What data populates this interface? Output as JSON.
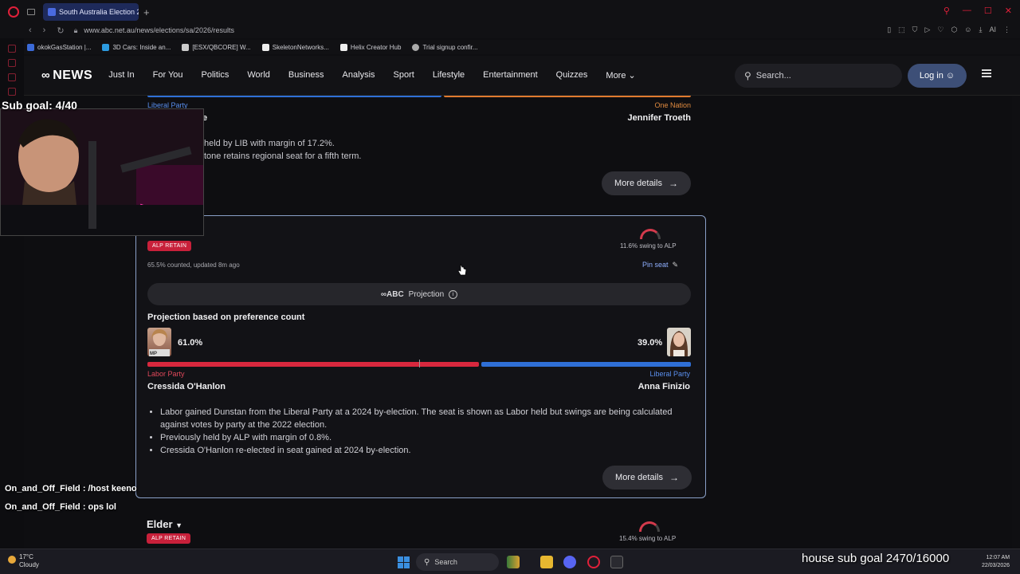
{
  "browser": {
    "tab_title": "South Australia Election 20",
    "url": "www.abc.net.au/news/elections/sa/2026/results",
    "bookmarks": [
      "okokGasStation |...",
      "3D Cars: Inside an...",
      "[ESX/QBCORE] W...",
      "SkeletonNetworks...",
      "Helix Creator Hub",
      "Trial signup confir..."
    ],
    "ai_label": "AI"
  },
  "site": {
    "logo": "NEWS",
    "nav": [
      "Just In",
      "For You",
      "Politics",
      "World",
      "Business",
      "Analysis",
      "Sport",
      "Lifestyle",
      "Entertainment",
      "Quizzes"
    ],
    "more": "More",
    "search_placeholder": "Search...",
    "login": "Log in"
  },
  "prev_card": {
    "left_party": "Liberal Party",
    "left_candidate_partial": "e",
    "right_party": "One Nation",
    "right_candidate": "Jennifer Troeth",
    "bullet1_partial": "held by LIB with margin of 17.2%.",
    "bullet2_partial": "tone retains regional seat for a fifth term.",
    "more_details": "More details",
    "colors": {
      "lib": "#2f6fd6",
      "onenation": "#e07a2f"
    }
  },
  "main_card": {
    "badge": "ALP RETAIN",
    "counted": "65.5% counted, updated 8m ago",
    "swing": "11.6% swing to ALP",
    "pin": "Pin seat",
    "projection_brand": "ABC",
    "projection_label": "Projection",
    "projection_title": "Projection based on preference count",
    "left": {
      "pct": "61.0%",
      "party": "Labor Party",
      "candidate": "Cressida O'Hanlon",
      "mp_tag": "MP",
      "share": 61.0,
      "color": "#d8283e"
    },
    "right": {
      "pct": "39.0%",
      "party": "Liberal Party",
      "candidate": "Anna Finizio",
      "share": 39.0,
      "color": "#2f6fd6"
    },
    "bullets": [
      "Labor gained Dunstan from the Liberal Party at a 2024 by-election. The seat is shown as Labor held but swings are being calculated against votes by party at the 2022 election.",
      "Previously held by ALP with margin of 0.8%.",
      "Cressida O'Hanlon re-elected in seat gained at 2024 by-election."
    ],
    "more_details": "More details"
  },
  "next_card": {
    "seat": "Elder",
    "badge": "ALP RETAIN",
    "swing": "15.4% swing to ALP"
  },
  "stream": {
    "sub_goal": "Sub goal: 4/40",
    "chat": [
      {
        "nick": "On_and_Off_Field",
        "msg": ": /host keeno"
      },
      {
        "nick": "On_and_Off_Field",
        "msg": ": ops lol"
      }
    ],
    "house_goal": "house sub goal 2470/16000"
  },
  "taskbar": {
    "temp": "17°C",
    "weather": "Cloudy",
    "search": "Search",
    "time": "12:07 AM",
    "date": "22/03/2026",
    "notif_count": "3"
  }
}
